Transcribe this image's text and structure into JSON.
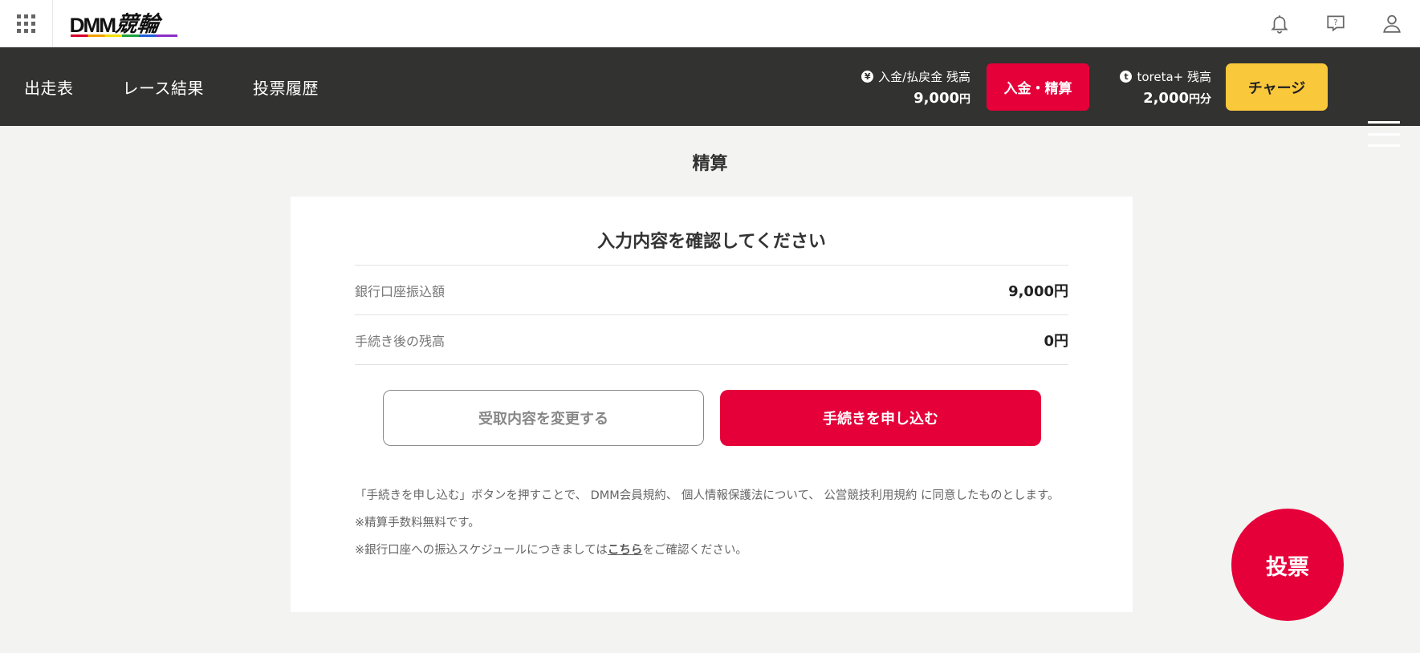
{
  "header": {
    "logo_text": "DMM",
    "logo_sub": "競輪",
    "icons": [
      "apps-grid-icon",
      "bell-icon",
      "help-icon",
      "user-icon"
    ]
  },
  "nav": {
    "links": [
      "出走表",
      "レース結果",
      "投票履歴"
    ],
    "deposit_balance": {
      "label": "入金/払戻金 残高",
      "amount": "9,000",
      "unit": "円",
      "coin": "¥"
    },
    "deposit_button": "入金・精算",
    "toreta_balance": {
      "label": "toreta+ 残高",
      "amount": "2,000",
      "unit": "円分",
      "coin": "t"
    },
    "charge_button": "チャージ"
  },
  "main": {
    "page_title": "精算",
    "card_title": "入力内容を確認してください",
    "rows": [
      {
        "label": "銀行口座振込額",
        "value": "9,000円"
      },
      {
        "label": "手続き後の残高",
        "value": "0円"
      }
    ],
    "change_button": "受取内容を変更する",
    "apply_button": "手続きを申し込む",
    "note_agreement": "「手続きを申し込む」ボタンを押すことで、 DMM会員規約、 個人情報保護法について、 公営競技利用規約 に同意したものとします。",
    "note_fee": "※精算手数料無料です。",
    "note_schedule_pre": "※銀行口座への振込スケジュールにつきましては",
    "note_schedule_link": "こちら",
    "note_schedule_post": "をご確認ください。"
  },
  "vote_button": "投票",
  "colors": {
    "accent_red": "#e5003a",
    "charge_yellow": "#fac83b",
    "nav_bg": "#323230",
    "page_bg": "#f3f3f1"
  }
}
